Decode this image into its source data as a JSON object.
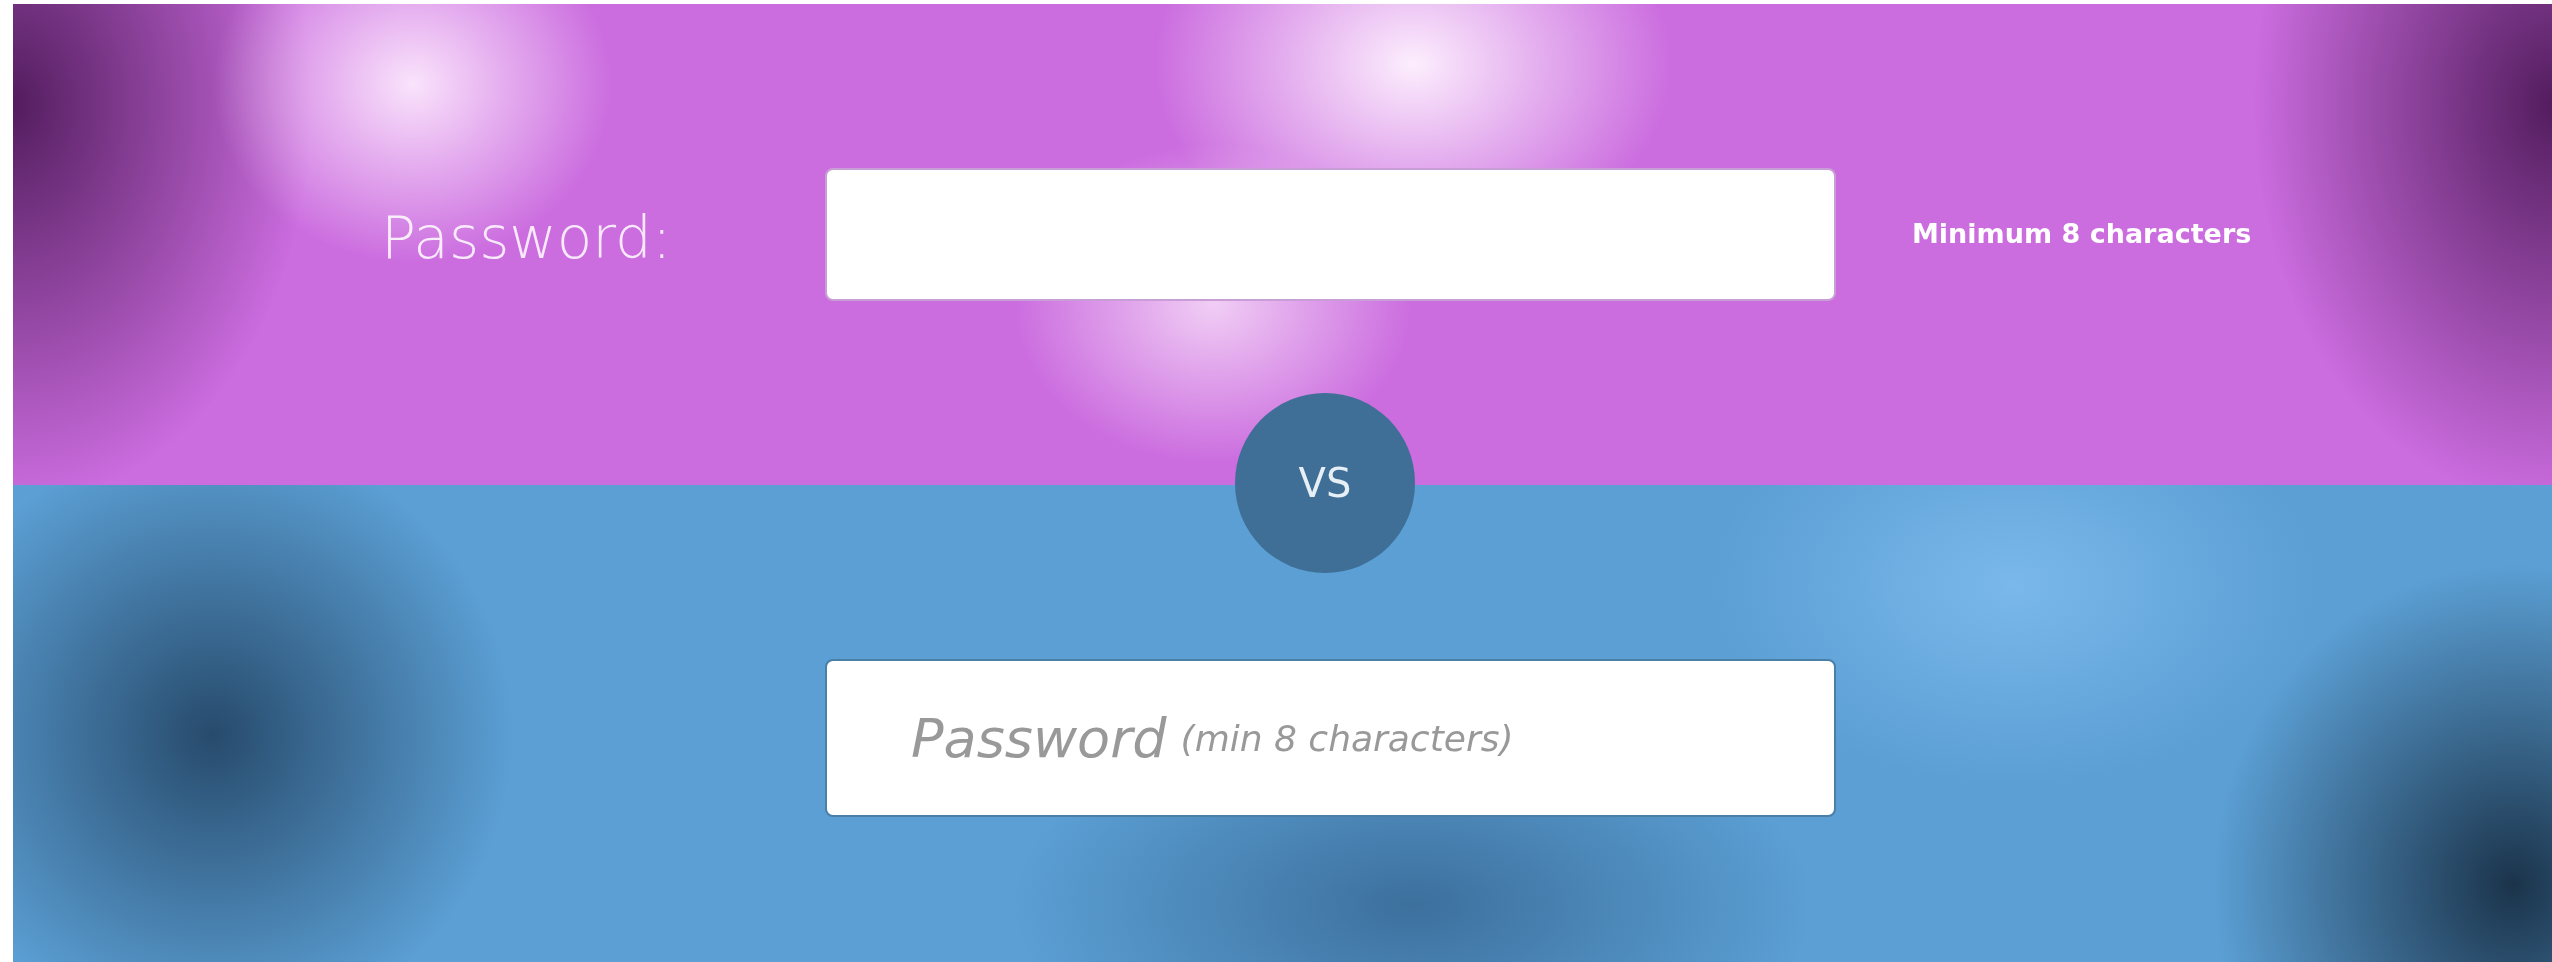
{
  "top_form": {
    "label": "Password:",
    "hint": "Minimum 8 characters"
  },
  "divider": {
    "text": "VS"
  },
  "bottom_form": {
    "placeholder": "Password",
    "placeholder_note": "(min 8 characters)"
  }
}
